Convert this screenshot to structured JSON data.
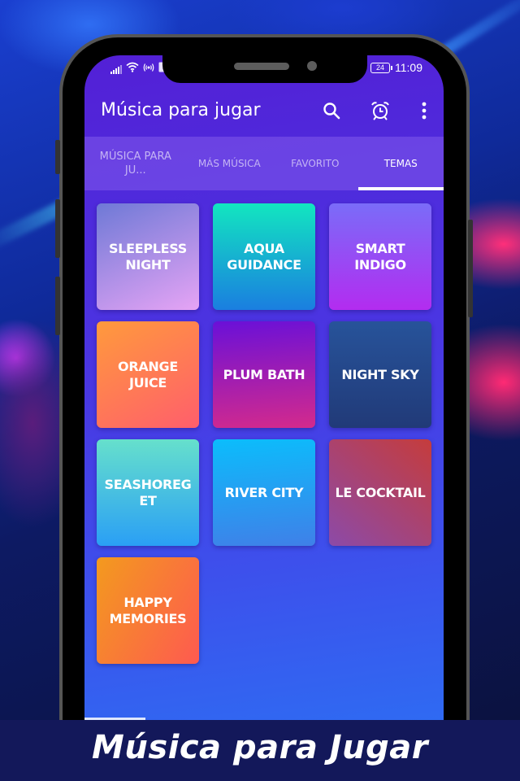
{
  "status_bar": {
    "time": "11:09",
    "battery_level": "24",
    "icons": [
      "signal-icon",
      "wifi-icon",
      "hotspot-icon",
      "notification-icon",
      "battery-icon"
    ]
  },
  "app_bar": {
    "title": "Música para jugar",
    "actions": [
      {
        "name": "search-button",
        "icon": "search-icon"
      },
      {
        "name": "alarm-button",
        "icon": "alarm-clock-icon"
      },
      {
        "name": "more-options-button",
        "icon": "more-vert-icon"
      }
    ]
  },
  "tabs": [
    {
      "label": "MÚSICA PARA JU...",
      "active": false
    },
    {
      "label": "MÁS MÚSICA",
      "active": false
    },
    {
      "label": "FAVORITO",
      "active": false
    },
    {
      "label": "TEMAS",
      "active": true
    }
  ],
  "themes": [
    {
      "label": "SLEEPLESS NIGHT",
      "gradient": [
        "#6e79d6",
        "#e6a4f5"
      ]
    },
    {
      "label": "AQUA GUIDANCE",
      "gradient": [
        "#12e6c0",
        "#1a7ee0"
      ]
    },
    {
      "label": "SMART INDIGO",
      "gradient": [
        "#7a6cf8",
        "#b32cf0"
      ]
    },
    {
      "label": "ORANGE JUICE",
      "gradient": [
        "#ff9a3c",
        "#ff5e6c"
      ]
    },
    {
      "label": "PLUM BATH",
      "gradient": [
        "#6a10d8",
        "#d42a8c"
      ]
    },
    {
      "label": "NIGHT SKY",
      "gradient": [
        "#27539a",
        "#213a78"
      ]
    },
    {
      "label": "SEASHOREGET",
      "gradient": [
        "#66e0cc",
        "#2a9ff5"
      ]
    },
    {
      "label": "RIVER CITY",
      "gradient": [
        "#0bbdfc",
        "#3f80e8"
      ]
    },
    {
      "label": "LE COCKTAIL",
      "gradient": [
        "#c53c3c",
        "#8c4aa8"
      ]
    },
    {
      "label": "HAPPY MEMORIES",
      "gradient": [
        "#f39a1e",
        "#fe5a50"
      ]
    }
  ],
  "colors": {
    "app_bar": "#5320d6",
    "tab_bar": "#7a4fe0",
    "active_indicator": "#ffffff",
    "banner_bg": "#13185a"
  },
  "banner": {
    "title": "Música para Jugar"
  }
}
